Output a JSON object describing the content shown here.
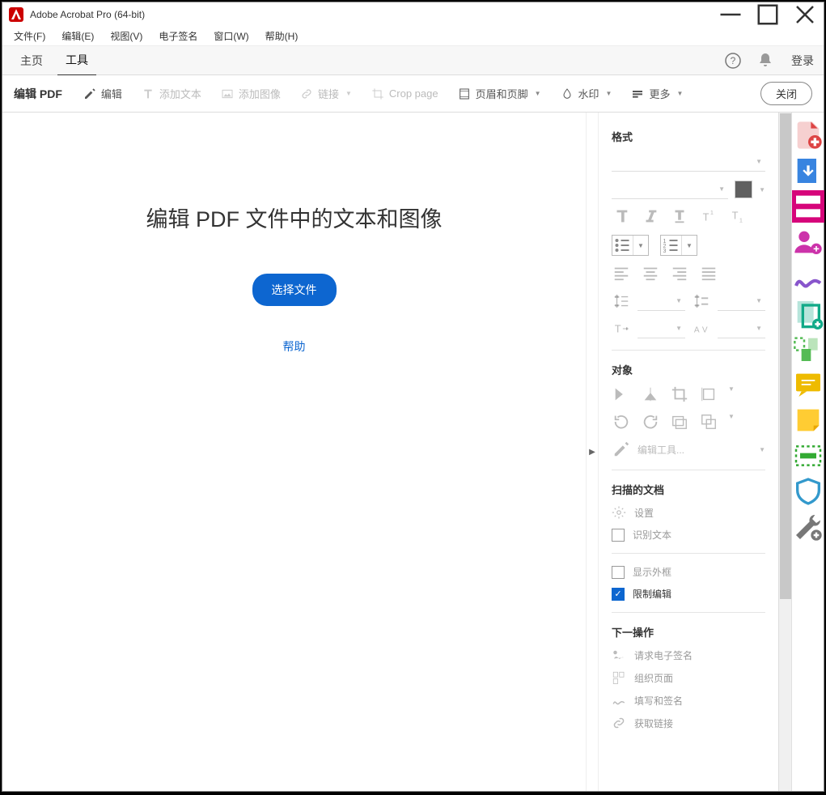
{
  "titlebar": {
    "title": "Adobe Acrobat Pro (64-bit)"
  },
  "menu": {
    "file": "文件(F)",
    "edit": "编辑(E)",
    "view": "视图(V)",
    "sign": "电子签名",
    "window": "窗口(W)",
    "help": "帮助(H)"
  },
  "tabs": {
    "home": "主页",
    "tools": "工具",
    "login": "登录"
  },
  "toolbar": {
    "title": "编辑 PDF",
    "edit": "编辑",
    "addtext": "添加文本",
    "addimage": "添加图像",
    "link": "链接",
    "crop": "Crop page",
    "header": "页眉和页脚",
    "watermark": "水印",
    "more": "更多",
    "close": "关闭"
  },
  "main": {
    "heading": "编辑 PDF 文件中的文本和图像",
    "select": "选择文件",
    "help": "帮助"
  },
  "panel": {
    "format": "格式",
    "object": "对象",
    "edittools": "编辑工具...",
    "scanned": "扫描的文档",
    "settings": "设置",
    "ocr": "识别文本",
    "outline": "显示外框",
    "restrict": "限制编辑",
    "next": "下一操作",
    "reqsign": "请求电子签名",
    "organize": "组织页面",
    "fillsign": "填写和签名",
    "getlinks": "获取链接"
  }
}
